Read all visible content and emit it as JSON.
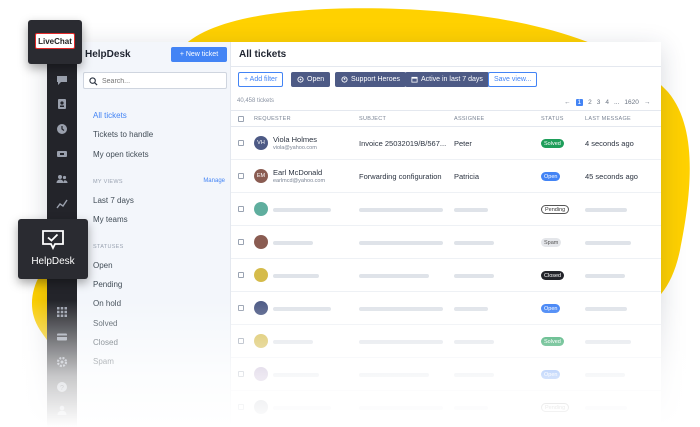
{
  "colors": {
    "accent": "#4384f5",
    "brand_yellow": "#ffd100",
    "rail": "#23242a"
  },
  "logos": {
    "livechat": "LiveChat",
    "helpdesk": "HelpDesk"
  },
  "sidebar": {
    "title": "HelpDesk",
    "new_ticket": "+ New ticket",
    "search_placeholder": "Search...",
    "items": [
      "All tickets",
      "Tickets to handle",
      "My open tickets"
    ],
    "my_views_label": "MY VIEWS",
    "manage": "Manage",
    "views": [
      "Last 7 days",
      "My teams"
    ],
    "statuses_label": "STATUSES",
    "statuses": [
      "Open",
      "Pending",
      "On hold",
      "Solved",
      "Closed",
      "Spam"
    ]
  },
  "rail_icons": [
    "chat-icon",
    "contact-icon",
    "clock-icon",
    "ticket-icon",
    "people-icon",
    "chart-icon",
    "apps-icon",
    "billing-icon",
    "settings-icon",
    "help-icon",
    "user-icon"
  ],
  "main": {
    "title": "All tickets",
    "filters": {
      "add": "+ Add filter",
      "open": "Open",
      "team": "Support Heroes",
      "date": "Active in last 7 days",
      "save": "Save view..."
    },
    "count": "40,458 tickets",
    "pagination": {
      "prev": "←",
      "pages": [
        "1",
        "2",
        "3",
        "4",
        "...",
        "1620"
      ],
      "next": "→"
    },
    "columns": [
      "REQUESTER",
      "SUBJECT",
      "ASSIGNEE",
      "STATUS",
      "LAST MESSAGE"
    ],
    "tickets": [
      {
        "initials": "VH",
        "name": "Viola Holmes",
        "email": "viola@yahoo.com",
        "subject": "Invoice 25032019/B/567...",
        "assignee": "Peter",
        "status": "Solved",
        "last": "4 seconds ago"
      },
      {
        "initials": "EM",
        "name": "Earl McDonald",
        "email": "earlmcd@yahoo.com",
        "subject": "Forwarding configuration",
        "assignee": "Patricia",
        "status": "Open",
        "last": "45 seconds ago"
      }
    ],
    "placeholder_statuses": [
      "Pending",
      "Spam",
      "Closed",
      "Open",
      "Solved",
      "Open",
      "Pending"
    ]
  }
}
